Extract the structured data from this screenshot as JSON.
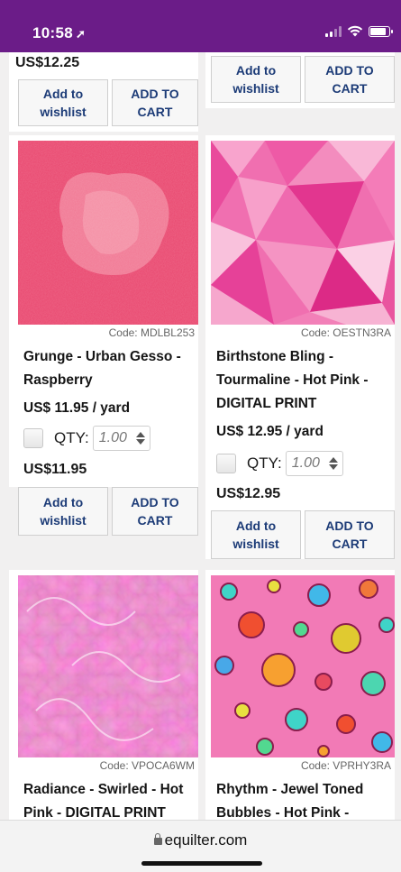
{
  "status_bar": {
    "time": "10:58",
    "location_glyph": "➚",
    "background": "#6b1c88"
  },
  "top_row": {
    "left": {
      "price": "US$12.25",
      "wishlist_label_1": "Add to",
      "wishlist_label_2": "wishlist",
      "cart_label_1": "ADD TO",
      "cart_label_2": "CART"
    },
    "right": {
      "wishlist_label_1": "Add to",
      "wishlist_label_2": "wishlist",
      "cart_label_1": "ADD TO",
      "cart_label_2": "CART"
    }
  },
  "products": [
    {
      "code": "Code: MDLBL253",
      "title_lines": [
        "Grunge - Urban Gesso -",
        "Raspberry"
      ],
      "unit_price": "US$ 11.95 / yard",
      "qty_label": "QTY:",
      "qty_value": "1.00",
      "total_price": "US$11.95",
      "wishlist_label_1": "Add to",
      "wishlist_label_2": "wishlist",
      "cart_label_1": "ADD TO",
      "cart_label_2": "CART"
    },
    {
      "code": "Code: OESTN3RA",
      "title_lines": [
        "Birthstone Bling -",
        "Tourmaline - Hot Pink -",
        "DIGITAL PRINT"
      ],
      "unit_price": "US$ 12.95 / yard",
      "qty_label": "QTY:",
      "qty_value": "1.00",
      "total_price": "US$12.95",
      "wishlist_label_1": "Add to",
      "wishlist_label_2": "wishlist",
      "cart_label_1": "ADD TO",
      "cart_label_2": "CART"
    },
    {
      "code": "Code: VPOCA6WM",
      "title_lines": [
        "Radiance - Swirled - Hot",
        "Pink - DIGITAL PRINT"
      ]
    },
    {
      "code": "Code: VPRHY3RA",
      "title_lines": [
        "Rhythm - Jewel Toned",
        "Bubbles - Hot Pink -"
      ]
    }
  ],
  "url_bar": {
    "domain": "equilter.com"
  },
  "colors": {
    "link_blue": "#1c3b77",
    "page_gray": "#f1f0f0"
  }
}
